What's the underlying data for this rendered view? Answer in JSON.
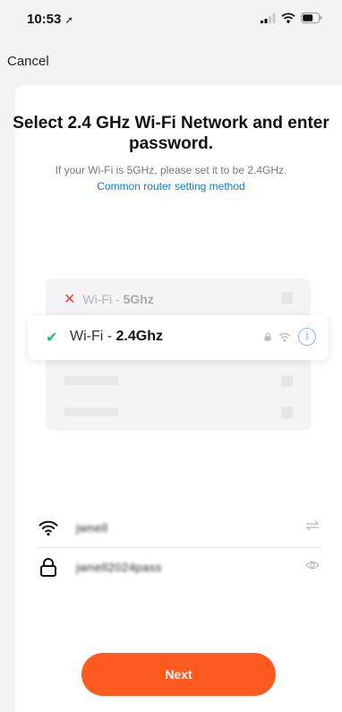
{
  "status": {
    "time": "10:53",
    "location_arrow": "➚"
  },
  "nav": {
    "cancel_label": "Cancel"
  },
  "header": {
    "title": "Select 2.4 GHz Wi-Fi Network and enter password.",
    "hint": "If your Wi-Fi is 5GHz, please set it to be 2.4GHz.",
    "link": "Common router setting method"
  },
  "illustration": {
    "bad": {
      "prefix": "Wi-Fi - ",
      "band": "5Ghz"
    },
    "good": {
      "prefix": "Wi-Fi - ",
      "band": "2.4Ghz"
    },
    "info_glyph": "i"
  },
  "form": {
    "ssid_value": "jwnell",
    "password_value": "jwnell2024pass"
  },
  "actions": {
    "next_label": "Next"
  },
  "colors": {
    "accent": "#ff5a1f",
    "link": "#1677d9",
    "ok": "#2bb673",
    "error": "#f0453a"
  }
}
